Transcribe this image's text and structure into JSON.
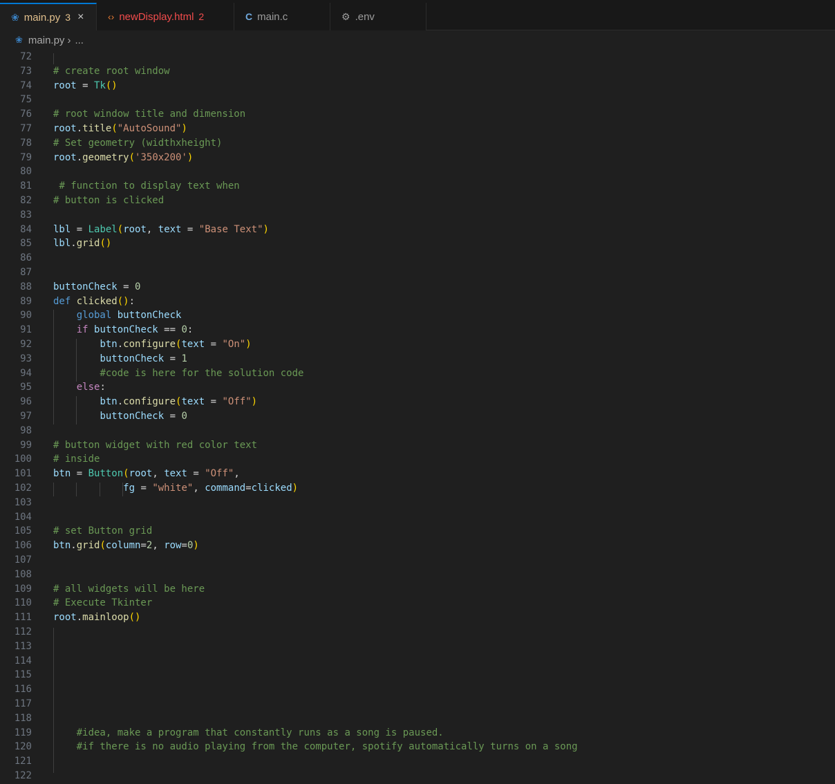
{
  "tabs": [
    {
      "icon": "python-file-icon",
      "label": "main.py",
      "badge": "3",
      "active": true,
      "close": "×"
    },
    {
      "icon": "html-file-icon",
      "label": "newDisplay.html",
      "badge": "2",
      "active": false
    },
    {
      "icon": "c-file-icon",
      "label": "main.c",
      "badge": "",
      "active": false
    },
    {
      "icon": "gear-icon",
      "label": ".env",
      "badge": "",
      "active": false
    }
  ],
  "breadcrumb": {
    "file": "main.py",
    "rest": "..."
  },
  "colors": {
    "tab_active_text": "#e2c08d",
    "html_tab_text": "#f14c4c",
    "accent": "#0078d4"
  },
  "lines": [
    {
      "n": "72",
      "tokens": []
    },
    {
      "n": "73",
      "tokens": [
        [
          "com",
          "# create root window"
        ]
      ]
    },
    {
      "n": "74",
      "tokens": [
        [
          "var",
          "root"
        ],
        [
          "op",
          " = "
        ],
        [
          "cls",
          "Tk"
        ],
        [
          "br1",
          "()"
        ]
      ]
    },
    {
      "n": "75",
      "tokens": []
    },
    {
      "n": "76",
      "tokens": [
        [
          "com",
          "# root window title and dimension"
        ]
      ]
    },
    {
      "n": "77",
      "tokens": [
        [
          "var",
          "root"
        ],
        [
          "op",
          "."
        ],
        [
          "fn",
          "title"
        ],
        [
          "br1",
          "("
        ],
        [
          "str",
          "\"AutoSound\""
        ],
        [
          "br1",
          ")"
        ]
      ]
    },
    {
      "n": "78",
      "tokens": [
        [
          "com",
          "# Set geometry (widthxheight)"
        ]
      ]
    },
    {
      "n": "79",
      "tokens": [
        [
          "var",
          "root"
        ],
        [
          "op",
          "."
        ],
        [
          "fn",
          "geometry"
        ],
        [
          "br1",
          "("
        ],
        [
          "str",
          "'350x200'"
        ],
        [
          "br1",
          ")"
        ]
      ]
    },
    {
      "n": "80",
      "tokens": []
    },
    {
      "n": "81",
      "tokens": [
        [
          "op",
          " "
        ],
        [
          "com",
          "# function to display text when"
        ]
      ]
    },
    {
      "n": "82",
      "tokens": [
        [
          "com",
          "# button is clicked"
        ]
      ]
    },
    {
      "n": "83",
      "tokens": []
    },
    {
      "n": "84",
      "tokens": [
        [
          "var",
          "lbl"
        ],
        [
          "op",
          " = "
        ],
        [
          "cls",
          "Label"
        ],
        [
          "br1",
          "("
        ],
        [
          "var",
          "root"
        ],
        [
          "op",
          ", "
        ],
        [
          "var",
          "text"
        ],
        [
          "op",
          " = "
        ],
        [
          "str",
          "\"Base Text\""
        ],
        [
          "br1",
          ")"
        ]
      ]
    },
    {
      "n": "85",
      "tokens": [
        [
          "var",
          "lbl"
        ],
        [
          "op",
          "."
        ],
        [
          "fn",
          "grid"
        ],
        [
          "br1",
          "()"
        ]
      ]
    },
    {
      "n": "86",
      "tokens": []
    },
    {
      "n": "87",
      "tokens": []
    },
    {
      "n": "88",
      "tokens": [
        [
          "var",
          "buttonCheck"
        ],
        [
          "op",
          " = "
        ],
        [
          "num",
          "0"
        ]
      ]
    },
    {
      "n": "89",
      "tokens": [
        [
          "kw",
          "def"
        ],
        [
          "op",
          " "
        ],
        [
          "fn",
          "clicked"
        ],
        [
          "br1",
          "()"
        ],
        [
          "op",
          ":"
        ]
      ]
    },
    {
      "n": "90",
      "tokens": [
        [
          "op",
          "    "
        ],
        [
          "kw",
          "global"
        ],
        [
          "op",
          " "
        ],
        [
          "var",
          "buttonCheck"
        ]
      ]
    },
    {
      "n": "91",
      "tokens": [
        [
          "op",
          "    "
        ],
        [
          "ctl",
          "if"
        ],
        [
          "op",
          " "
        ],
        [
          "var",
          "buttonCheck"
        ],
        [
          "op",
          " == "
        ],
        [
          "num",
          "0"
        ],
        [
          "op",
          ":"
        ]
      ]
    },
    {
      "n": "92",
      "tokens": [
        [
          "op",
          "        "
        ],
        [
          "var",
          "btn"
        ],
        [
          "op",
          "."
        ],
        [
          "fn",
          "configure"
        ],
        [
          "br1",
          "("
        ],
        [
          "var",
          "text"
        ],
        [
          "op",
          " = "
        ],
        [
          "str",
          "\"On\""
        ],
        [
          "br1",
          ")"
        ]
      ]
    },
    {
      "n": "93",
      "tokens": [
        [
          "op",
          "        "
        ],
        [
          "var",
          "buttonCheck"
        ],
        [
          "op",
          " = "
        ],
        [
          "num",
          "1"
        ]
      ]
    },
    {
      "n": "94",
      "tokens": [
        [
          "op",
          "        "
        ],
        [
          "com",
          "#code is here for the solution code"
        ]
      ]
    },
    {
      "n": "95",
      "tokens": [
        [
          "op",
          "    "
        ],
        [
          "ctl",
          "else"
        ],
        [
          "op",
          ":"
        ]
      ]
    },
    {
      "n": "96",
      "tokens": [
        [
          "op",
          "        "
        ],
        [
          "var",
          "btn"
        ],
        [
          "op",
          "."
        ],
        [
          "fn",
          "configure"
        ],
        [
          "br1",
          "("
        ],
        [
          "var",
          "text"
        ],
        [
          "op",
          " = "
        ],
        [
          "str",
          "\"Off\""
        ],
        [
          "br1",
          ")"
        ]
      ]
    },
    {
      "n": "97",
      "tokens": [
        [
          "op",
          "        "
        ],
        [
          "var",
          "buttonCheck"
        ],
        [
          "op",
          " = "
        ],
        [
          "num",
          "0"
        ]
      ]
    },
    {
      "n": "98",
      "tokens": []
    },
    {
      "n": "99",
      "tokens": [
        [
          "com",
          "# button widget with red color text"
        ]
      ]
    },
    {
      "n": "100",
      "tokens": [
        [
          "com",
          "# inside"
        ]
      ]
    },
    {
      "n": "101",
      "tokens": [
        [
          "var",
          "btn"
        ],
        [
          "op",
          " = "
        ],
        [
          "cls",
          "Button"
        ],
        [
          "br1",
          "("
        ],
        [
          "var",
          "root"
        ],
        [
          "op",
          ", "
        ],
        [
          "var",
          "text"
        ],
        [
          "op",
          " = "
        ],
        [
          "str",
          "\"Off\""
        ],
        [
          "op",
          ","
        ]
      ]
    },
    {
      "n": "102",
      "tokens": [
        [
          "op",
          "            "
        ],
        [
          "var",
          "fg"
        ],
        [
          "op",
          " = "
        ],
        [
          "str",
          "\"white\""
        ],
        [
          "op",
          ", "
        ],
        [
          "var",
          "command"
        ],
        [
          "op",
          "="
        ],
        [
          "var",
          "clicked"
        ],
        [
          "br1",
          ")"
        ]
      ]
    },
    {
      "n": "103",
      "tokens": []
    },
    {
      "n": "104",
      "tokens": []
    },
    {
      "n": "105",
      "tokens": [
        [
          "com",
          "# set Button grid"
        ]
      ]
    },
    {
      "n": "106",
      "tokens": [
        [
          "var",
          "btn"
        ],
        [
          "op",
          "."
        ],
        [
          "fn",
          "grid"
        ],
        [
          "br1",
          "("
        ],
        [
          "var",
          "column"
        ],
        [
          "op",
          "="
        ],
        [
          "num",
          "2"
        ],
        [
          "op",
          ", "
        ],
        [
          "var",
          "row"
        ],
        [
          "op",
          "="
        ],
        [
          "num",
          "0"
        ],
        [
          "br1",
          ")"
        ]
      ]
    },
    {
      "n": "107",
      "tokens": []
    },
    {
      "n": "108",
      "tokens": []
    },
    {
      "n": "109",
      "tokens": [
        [
          "com",
          "# all widgets will be here"
        ]
      ]
    },
    {
      "n": "110",
      "tokens": [
        [
          "com",
          "# Execute Tkinter"
        ]
      ]
    },
    {
      "n": "111",
      "tokens": [
        [
          "var",
          "root"
        ],
        [
          "op",
          "."
        ],
        [
          "fn",
          "mainloop"
        ],
        [
          "br1",
          "()"
        ]
      ]
    },
    {
      "n": "112",
      "tokens": []
    },
    {
      "n": "113",
      "tokens": []
    },
    {
      "n": "114",
      "tokens": []
    },
    {
      "n": "115",
      "tokens": []
    },
    {
      "n": "116",
      "tokens": []
    },
    {
      "n": "117",
      "tokens": []
    },
    {
      "n": "118",
      "tokens": []
    },
    {
      "n": "119",
      "tokens": [
        [
          "op",
          "    "
        ],
        [
          "com",
          "#idea, make a program that constantly runs as a song is paused."
        ]
      ]
    },
    {
      "n": "120",
      "tokens": [
        [
          "op",
          "    "
        ],
        [
          "com",
          "#if there is no audio playing from the computer, spotify automatically turns on a song"
        ]
      ]
    },
    {
      "n": "121",
      "tokens": []
    },
    {
      "n": "122",
      "tokens": []
    }
  ]
}
